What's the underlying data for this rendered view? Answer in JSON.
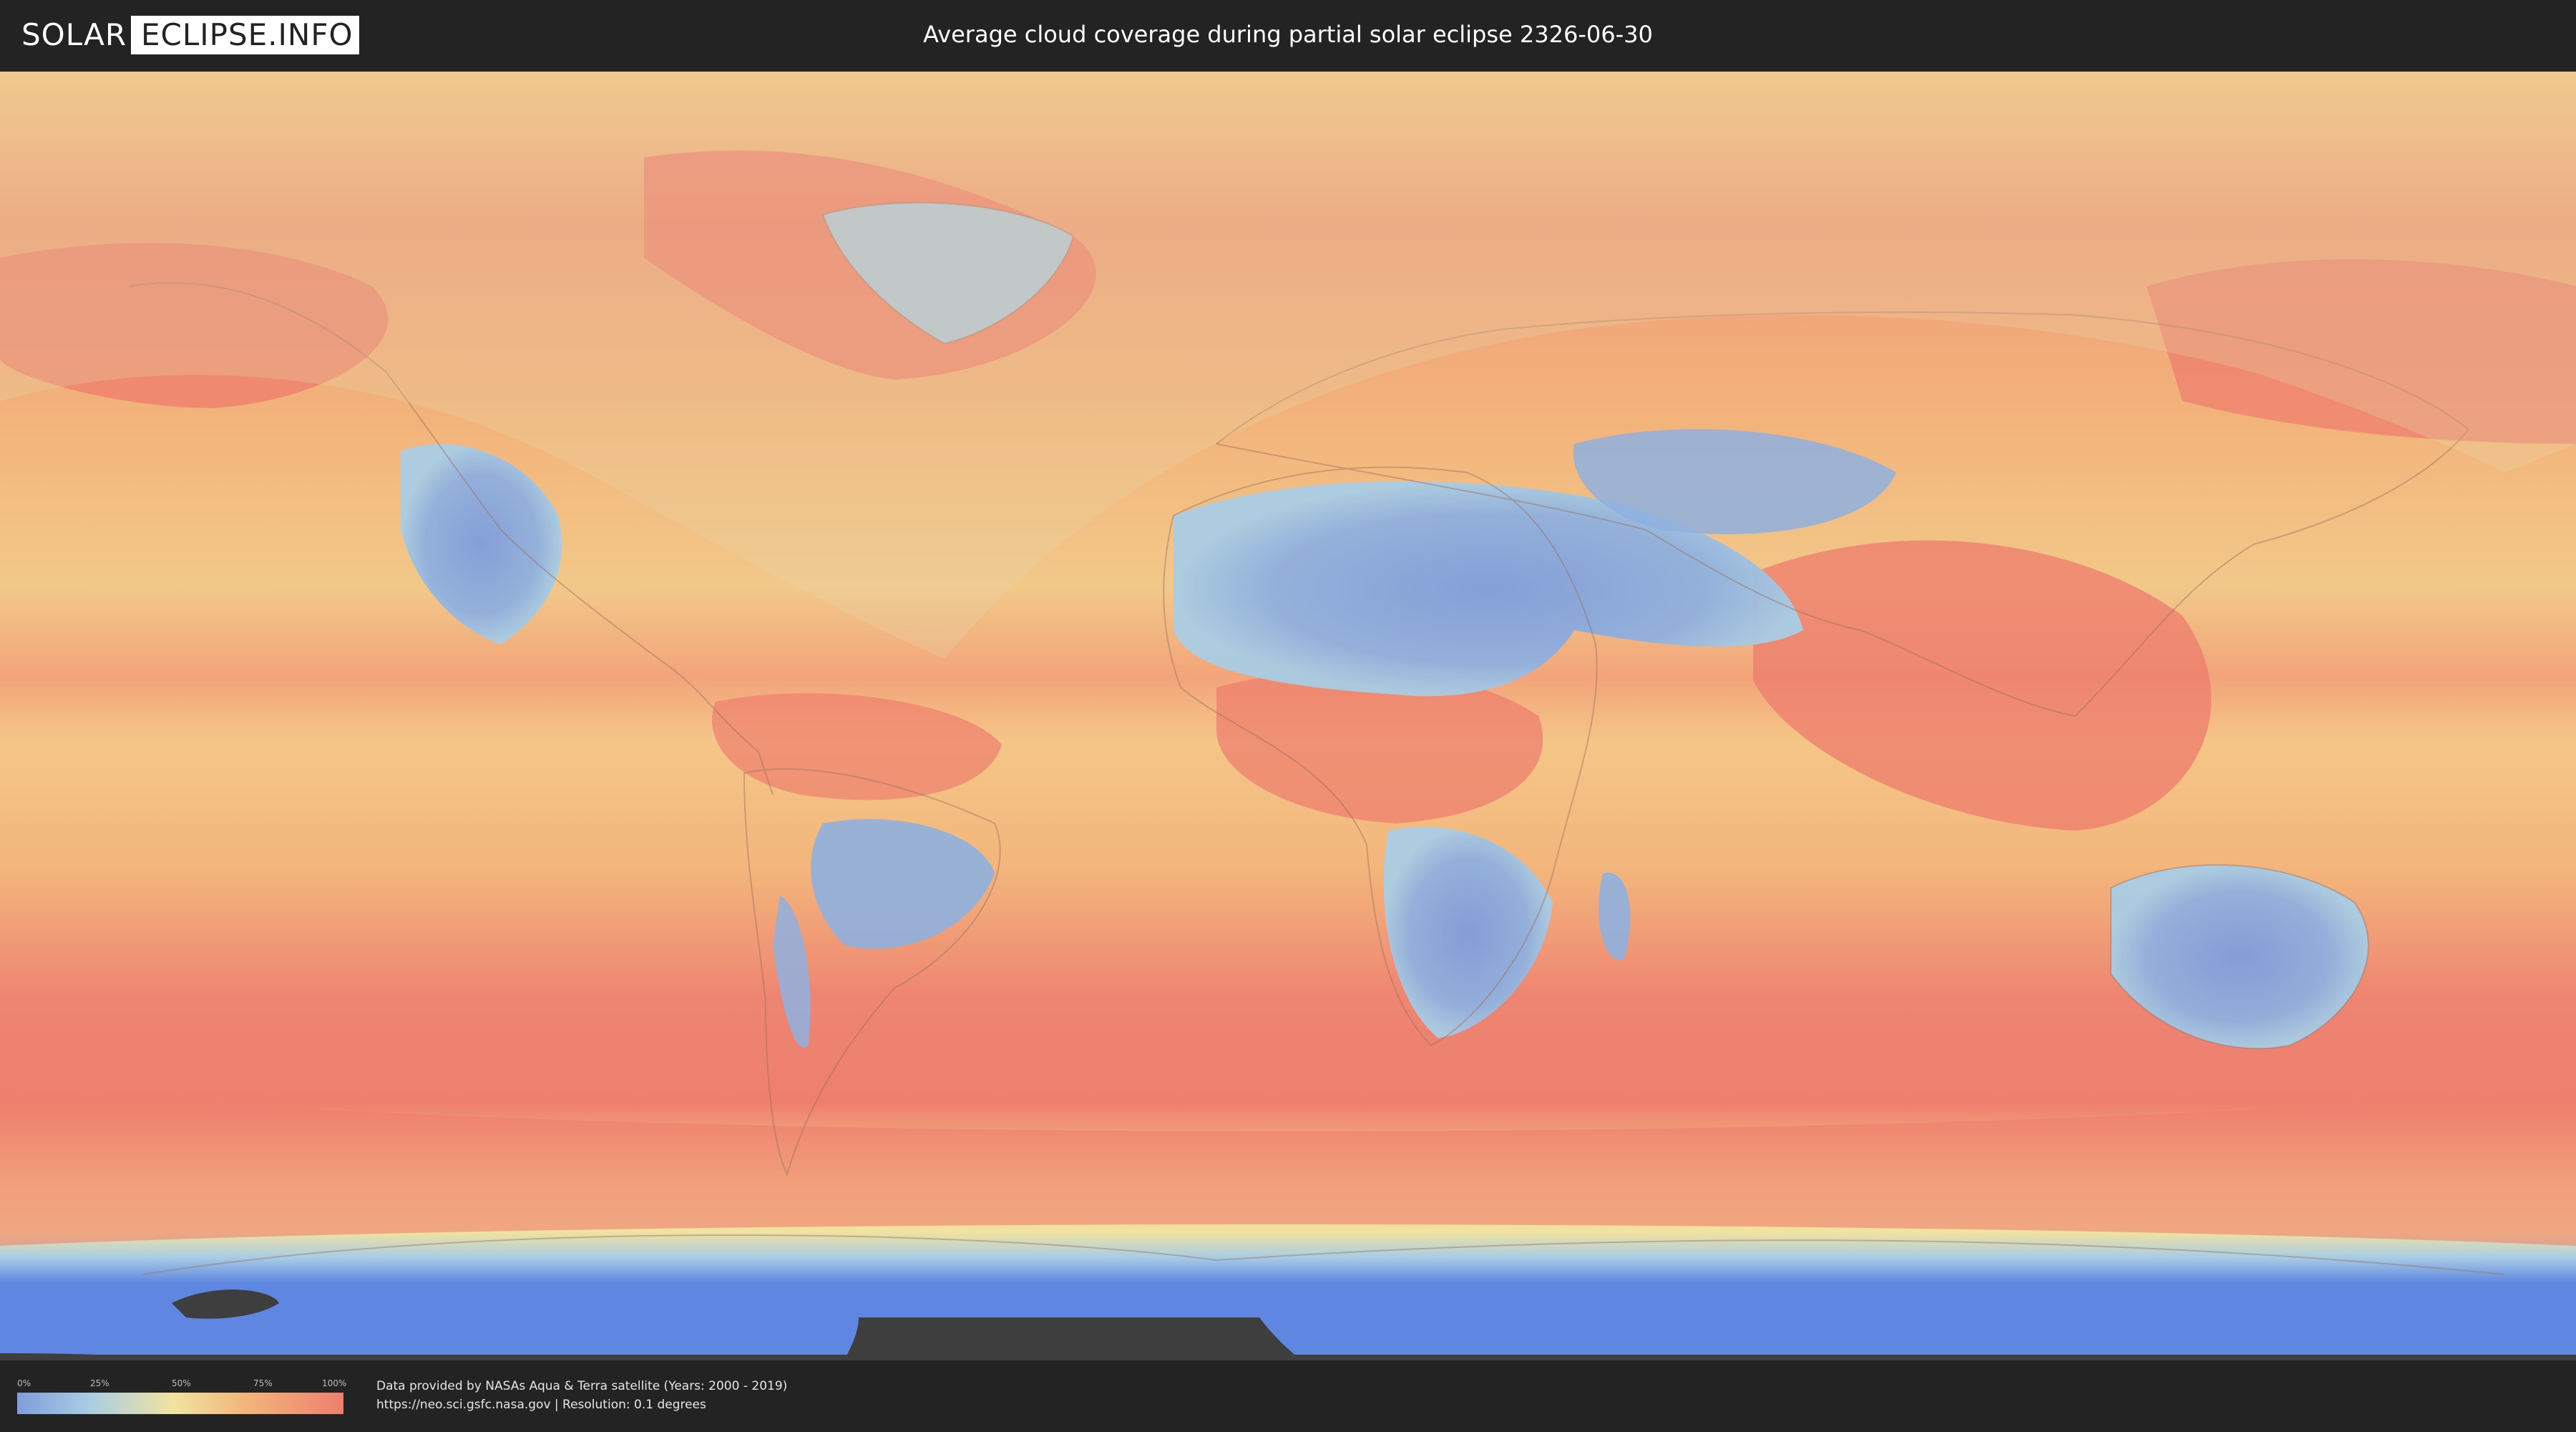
{
  "header": {
    "logo_left": "SOLAR",
    "logo_right": "ECLIPSE.INFO",
    "title": "Average cloud coverage during partial solar eclipse 2326-06-30"
  },
  "map": {
    "projection": "equirectangular",
    "content": "average cloud coverage world map with eclipse visibility overlay",
    "palette": {
      "ocean_cloudy": "#ee7f6e",
      "moderate": "#f3b57b",
      "mid": "#f2e3a0",
      "clear": "#a9cde4",
      "very_clear": "#7e9ddb",
      "antarctica": "#5f86e0",
      "no_data": "#3e3e3e"
    },
    "overlay_color": "#e6d8a8"
  },
  "legend": {
    "ticks": [
      "0%",
      "25%",
      "50%",
      "75%",
      "100%"
    ],
    "colors": [
      "#7e9ddb",
      "#a9cde4",
      "#f2e3a0",
      "#f3b57b",
      "#ee7f6e"
    ]
  },
  "footer": {
    "credit_line1": "Data provided by NASAs Aqua & Terra satellite (Years: 2000 - 2019)",
    "credit_line2": "https://neo.sci.gsfc.nasa.gov | Resolution: 0.1 degrees"
  }
}
